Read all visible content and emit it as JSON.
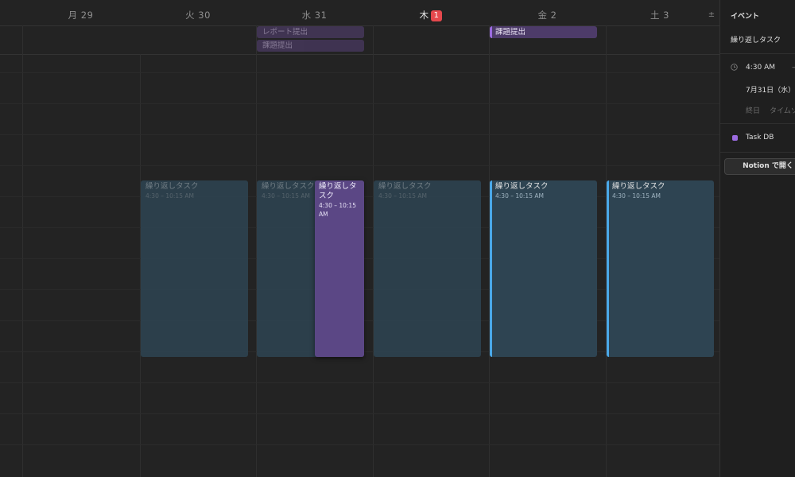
{
  "calendar": {
    "days": [
      {
        "label": "月 29",
        "today": false
      },
      {
        "label": "火 30",
        "today": false
      },
      {
        "label": "水 31",
        "today": false
      },
      {
        "label": "木",
        "today": true,
        "badge": "1"
      },
      {
        "label": "金 2",
        "today": false
      },
      {
        "label": "土 3",
        "today": false
      }
    ],
    "collapse_icon": "±",
    "allday_events": [
      {
        "title": "レポート提出",
        "day": "水 31"
      },
      {
        "title": "課題提出",
        "day": "水 31"
      },
      {
        "title": "課題提出",
        "day": "金 2"
      }
    ],
    "events": [
      {
        "title": "繰り返しタスク",
        "time": "4:30 – 10:15 AM",
        "day": "火 30"
      },
      {
        "title": "繰り返しタスク",
        "time": "4:30 – 10:15 AM",
        "day": "水 31"
      },
      {
        "title": "繰り返しタスク",
        "time": "4:30 – 10:15 AM",
        "day": "木 1"
      },
      {
        "title": "繰り返しタスク",
        "time": "4:30 – 10:15 AM",
        "day": "金 2"
      },
      {
        "title": "繰り返しタスク",
        "time": "4:30 – 10:15 AM",
        "day": "土 3"
      }
    ],
    "selected_event": {
      "title": "繰り返しタスク",
      "time": "4:30 – 10:15 AM"
    }
  },
  "panel": {
    "header": "イベント",
    "title": "繰り返しタスク",
    "time": "4:30 AM",
    "time_dash": "–",
    "date": "7月31日（水）",
    "allday_label": "終日",
    "timezone_label": "タイムゾ",
    "database": "Task DB",
    "open_button": "Notion で開く"
  },
  "colors": {
    "accent": "#9b6be0",
    "today_badge": "#e5484d",
    "event_bg": "#2e4452",
    "selected_event": "#5b4785",
    "current_border": "#4aa8e8"
  }
}
